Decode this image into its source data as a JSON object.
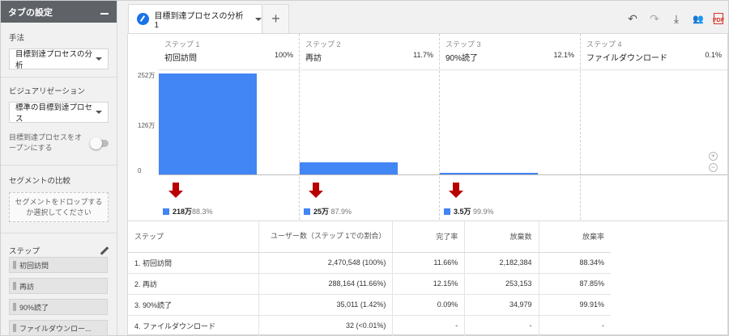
{
  "panel": {
    "title": "タブの設定",
    "technique_label": "手法",
    "technique_value": "目標到達プロセスの分析",
    "viz_label": "ビジュアリゼーション",
    "viz_value": "標準の目標到達プロセス",
    "open_funnel_label": "目標到達プロセスをオープンにする",
    "open_funnel_on": false,
    "segment_label": "セグメントの比較",
    "segment_drop_text": "セグメントをドロップするか選択してください",
    "steps_label": "ステップ",
    "steps": [
      "初回訪問",
      "再訪",
      "90%読了",
      "ファイルダウンロー..."
    ]
  },
  "tab": {
    "title": "目標到達プロセスの分析 1",
    "add_label": "+"
  },
  "toolbar": {
    "undo": "↶",
    "redo": "↷",
    "download": "⤓",
    "share": "👥",
    "pdf": "PDF"
  },
  "funnel": {
    "axis": {
      "top": "252万",
      "mid": "126万",
      "zero": "0"
    },
    "steps": [
      {
        "num": "ステップ 1",
        "name": "初回訪問",
        "pct": "100%",
        "drop_value": "218万",
        "drop_pct": "88.3%"
      },
      {
        "num": "ステップ 2",
        "name": "再訪",
        "pct": "11.7%",
        "drop_value": "25万",
        "drop_pct": "87.9%"
      },
      {
        "num": "ステップ 3",
        "name": "90%読了",
        "pct": "12.1%",
        "drop_value": "3.5万",
        "drop_pct": "99.9%"
      },
      {
        "num": "ステップ 4",
        "name": "ファイルダウンロード",
        "pct": "0.1%"
      }
    ],
    "users": [
      2470548,
      288164,
      35011,
      32
    ],
    "axis_max": 2520000,
    "bar_color": "#4285f4",
    "drop_color": "#b80000",
    "zoom_in": "+",
    "zoom_out": "−"
  },
  "table": {
    "headers": {
      "step": "ステップ",
      "users": "ユーザー数（ステップ 1での割合）",
      "completion": "完了率",
      "abandon": "放棄数",
      "abandon_rate": "放棄率"
    },
    "rows": [
      {
        "step": "1. 初回訪問",
        "users": "2,470,548 (100%)",
        "completion": "11.66%",
        "abandon": "2,182,384",
        "abandon_rate": "88.34%"
      },
      {
        "step": "2. 再訪",
        "users": "288,164 (11.66%)",
        "completion": "12.15%",
        "abandon": "253,153",
        "abandon_rate": "87.85%"
      },
      {
        "step": "3. 90%読了",
        "users": "35,011 (1.42%)",
        "completion": "0.09%",
        "abandon": "34,979",
        "abandon_rate": "99.91%"
      },
      {
        "step": "4. ファイルダウンロード",
        "users": "32 (<0.01%)",
        "completion": "-",
        "abandon": "-",
        "abandon_rate": "-"
      }
    ]
  }
}
